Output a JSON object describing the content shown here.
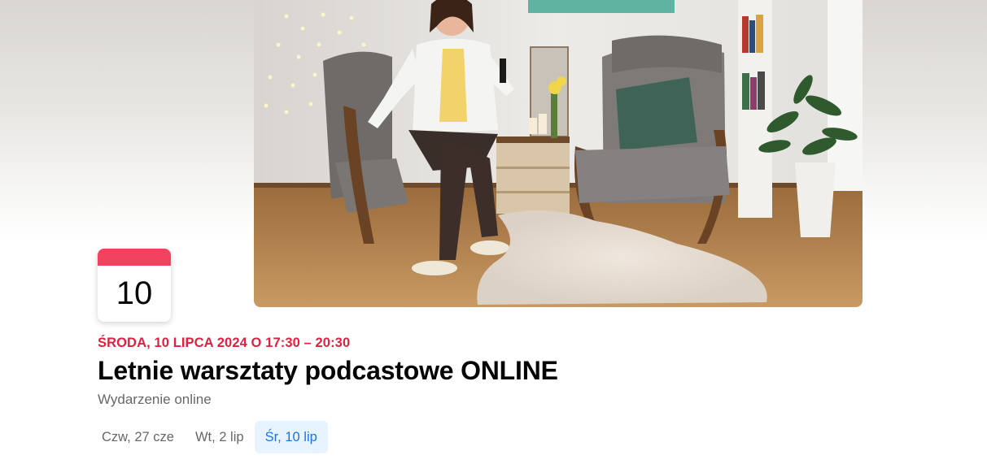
{
  "event": {
    "calendar_day": "10",
    "date_line": "ŚRODA, 10 LIPCA 2024 O 17:30 – 20:30",
    "title": "Letnie warsztaty podcastowe ONLINE",
    "subtitle": "Wydarzenie online"
  },
  "date_tabs": [
    {
      "label": "Czw, 27 cze",
      "selected": false
    },
    {
      "label": "Wt, 2 lip",
      "selected": false
    },
    {
      "label": "Śr, 10 lip",
      "selected": true
    }
  ],
  "colors": {
    "calendar_header": "#f3425f",
    "date_line": "#e41e3f",
    "active_tab_bg": "#e7f3ff",
    "active_tab_text": "#1b74e4"
  }
}
